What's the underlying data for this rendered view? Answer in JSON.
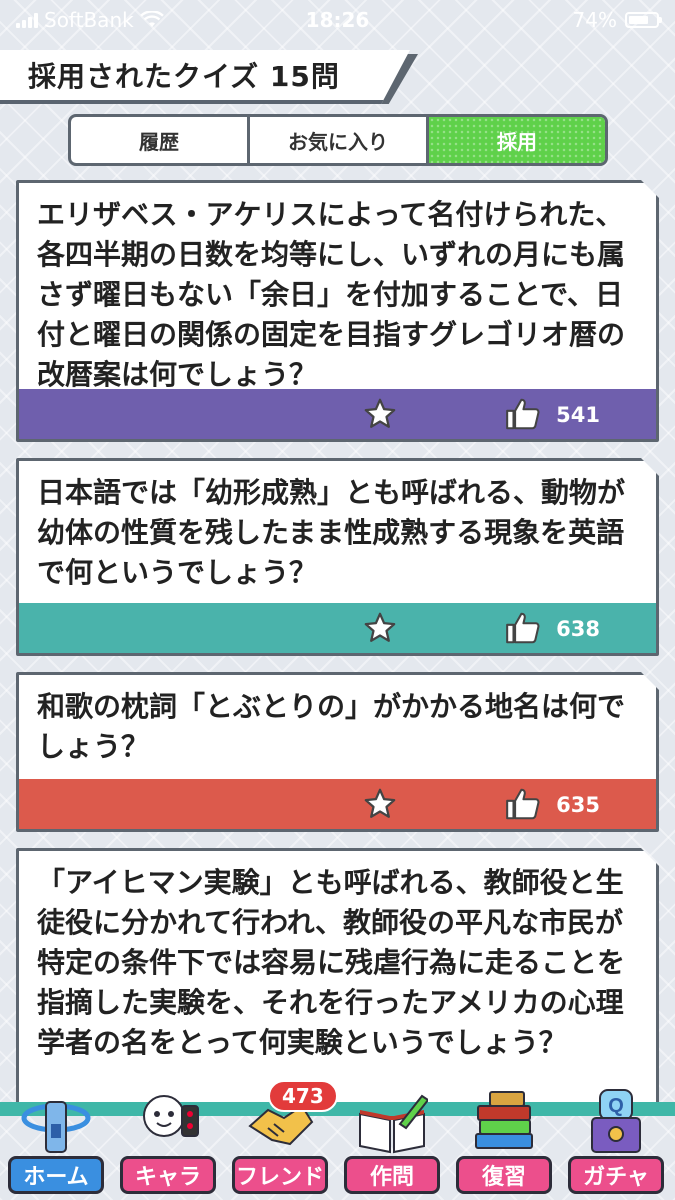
{
  "status": {
    "carrier": "SoftBank",
    "time": "18:26",
    "battery": "74%",
    "battery_level": 0.74
  },
  "header": {
    "title": "採用されたクイズ 15問"
  },
  "tabs": [
    {
      "label": "履歴",
      "active": false
    },
    {
      "label": "お気に入り",
      "active": false
    },
    {
      "label": "採用",
      "active": true
    }
  ],
  "quizzes": [
    {
      "question": "エリザベス・アケリスによって名付けられた、各四半期の日数を均等にし、いずれの月にも属さず曜日もない「余日」を付加することで、日付と曜日の関係の固定を目指すグレゴリオ暦の改暦案は何でしょう？",
      "likes": "541",
      "bar_color": "#6f5fad"
    },
    {
      "question": "日本語では「幼形成熟」とも呼ばれる、動物が幼体の性質を残したまま性成熟する現象を英語で何というでしょう？",
      "likes": "638",
      "bar_color": "#4ab3ab"
    },
    {
      "question": "和歌の枕詞「とぶとりの」がかかる地名は何でしょう？",
      "likes": "635",
      "bar_color": "#dc5a4c"
    },
    {
      "question": "「アイヒマン実験」とも呼ばれる、教師役と生徒役に分かれて行われ、教師役の平凡な市民が特定の条件下では容易に残虐行為に走ることを指摘した実験を、それを行ったアメリカの心理学者の名をとって何実験というでしょう？",
      "likes": "",
      "bar_color": "#4ab3ab"
    }
  ],
  "nav": {
    "items": [
      {
        "label": "ホーム",
        "icon": "home-tower-icon",
        "color": "#3a8fe0"
      },
      {
        "label": "キャラ",
        "icon": "character-icon",
        "color": "#ec4f8c"
      },
      {
        "label": "フレンド",
        "icon": "handshake-icon",
        "color": "#ec4f8c"
      },
      {
        "label": "作問",
        "icon": "book-pen-icon",
        "color": "#ec4f8c"
      },
      {
        "label": "復習",
        "icon": "books-stack-icon",
        "color": "#ec4f8c"
      },
      {
        "label": "ガチャ",
        "icon": "gacha-machine-icon",
        "color": "#ec4f8c"
      }
    ],
    "friend_badge": "473"
  }
}
